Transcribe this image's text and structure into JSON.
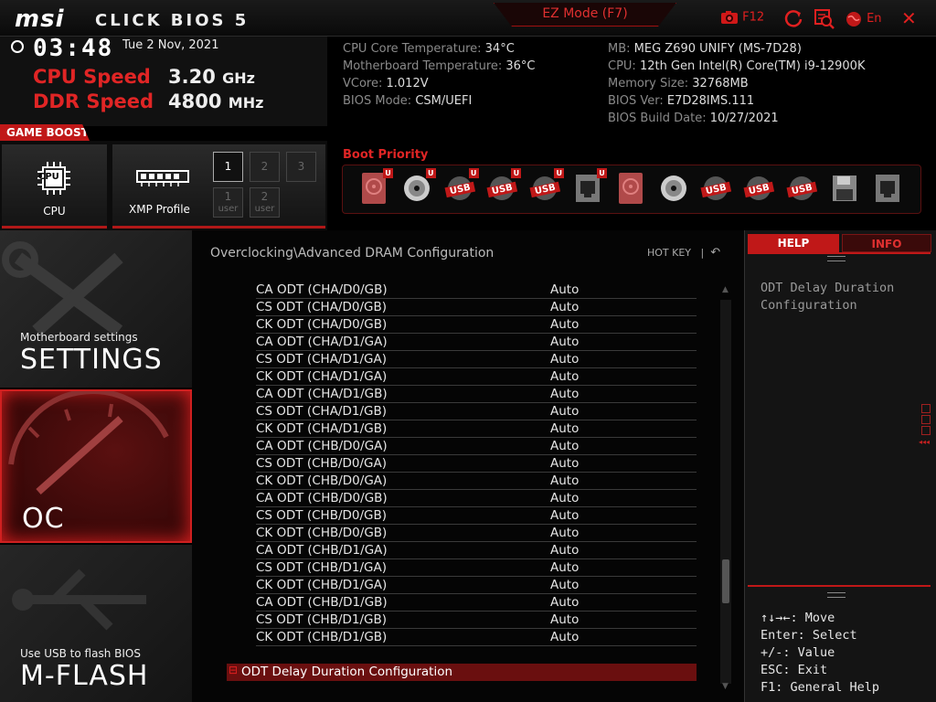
{
  "header": {
    "brand": "msi",
    "product": "CLICK BIOS 5",
    "ez_mode": "EZ Mode (F7)",
    "screenshot_label": "F12",
    "language": "En"
  },
  "status": {
    "time": "03:48",
    "date": "Tue  2 Nov, 2021",
    "cpu_speed_label": "CPU Speed",
    "cpu_speed_value": "3.20",
    "cpu_speed_unit": "GHz",
    "ddr_speed_label": "DDR Speed",
    "ddr_speed_value": "4800",
    "ddr_speed_unit": "MHz"
  },
  "sysinfo": {
    "left": [
      {
        "label": "CPU Core Temperature: ",
        "value": "34°C"
      },
      {
        "label": "Motherboard Temperature: ",
        "value": "36°C"
      },
      {
        "label": "VCore: ",
        "value": "1.012V"
      },
      {
        "label": "BIOS Mode: ",
        "value": "CSM/UEFI"
      }
    ],
    "right": [
      {
        "label": "MB: ",
        "value": "MEG Z690 UNIFY (MS-7D28)"
      },
      {
        "label": "CPU: ",
        "value": "12th Gen Intel(R) Core(TM) i9-12900K"
      },
      {
        "label": "Memory Size: ",
        "value": "32768MB"
      },
      {
        "label": "BIOS Ver: ",
        "value": "E7D28IMS.111"
      },
      {
        "label": "BIOS Build Date: ",
        "value": "10/27/2021"
      }
    ]
  },
  "game_boost": {
    "label": "GAME BOOST",
    "cpu_label": "CPU",
    "xmp_label": "XMP Profile",
    "profiles": [
      "1",
      "2",
      "3"
    ],
    "user_profiles": [
      {
        "num": "1",
        "sub": "user"
      },
      {
        "num": "2",
        "sub": "user"
      }
    ]
  },
  "boot": {
    "label": "Boot Priority",
    "devices": [
      "hdd-u",
      "disc-u",
      "usb-u",
      "usb-u",
      "usb-u",
      "lan-u",
      "hdd",
      "disc",
      "usb",
      "usb",
      "usb",
      "floppy",
      "lan"
    ],
    "usb_text": "USB",
    "u_badge": "U"
  },
  "nav": {
    "settings_sub": "Motherboard settings",
    "settings_main": "SETTINGS",
    "oc_main": "OC",
    "mflash_sub": "Use USB to flash BIOS",
    "mflash_main": "M-FLASH"
  },
  "main": {
    "path": "Overclocking\\Advanced DRAM Configuration",
    "hotkey": "HOT KEY",
    "hotkey_sep": "|",
    "rows": [
      {
        "label": "CA ODT (CHA/D0/GB)",
        "value": "Auto"
      },
      {
        "label": "CS ODT (CHA/D0/GB)",
        "value": "Auto"
      },
      {
        "label": "CK ODT (CHA/D0/GB)",
        "value": "Auto"
      },
      {
        "label": "CA ODT (CHA/D1/GA)",
        "value": "Auto"
      },
      {
        "label": "CS ODT (CHA/D1/GA)",
        "value": "Auto"
      },
      {
        "label": "CK ODT (CHA/D1/GA)",
        "value": "Auto"
      },
      {
        "label": "CA ODT (CHA/D1/GB)",
        "value": "Auto"
      },
      {
        "label": "CS ODT (CHA/D1/GB)",
        "value": "Auto"
      },
      {
        "label": "CK ODT (CHA/D1/GB)",
        "value": "Auto"
      },
      {
        "label": "CA ODT (CHB/D0/GA)",
        "value": "Auto"
      },
      {
        "label": "CS ODT (CHB/D0/GA)",
        "value": "Auto"
      },
      {
        "label": "CK ODT (CHB/D0/GA)",
        "value": "Auto"
      },
      {
        "label": "CA ODT (CHB/D0/GB)",
        "value": "Auto"
      },
      {
        "label": "CS ODT (CHB/D0/GB)",
        "value": "Auto"
      },
      {
        "label": "CK ODT (CHB/D0/GB)",
        "value": "Auto"
      },
      {
        "label": "CA ODT (CHB/D1/GA)",
        "value": "Auto"
      },
      {
        "label": "CS ODT (CHB/D1/GA)",
        "value": "Auto"
      },
      {
        "label": "CK ODT (CHB/D1/GA)",
        "value": "Auto"
      },
      {
        "label": "CA ODT (CHB/D1/GB)",
        "value": "Auto"
      },
      {
        "label": "CS ODT (CHB/D1/GB)",
        "value": "Auto"
      },
      {
        "label": "CK ODT (CHB/D1/GB)",
        "value": "Auto"
      }
    ],
    "selected_toggle": "⊟",
    "selected": "ODT Delay Duration Configuration"
  },
  "help": {
    "help_tab": "HELP",
    "info_tab": "INFO",
    "text": "ODT Delay Duration Configuration",
    "keys": [
      "↑↓→←: Move",
      "Enter: Select",
      "+/-: Value",
      "ESC: Exit",
      "F1: General Help"
    ]
  },
  "colors": {
    "accent": "#e02525",
    "selected_row": "#6a0f0f"
  }
}
